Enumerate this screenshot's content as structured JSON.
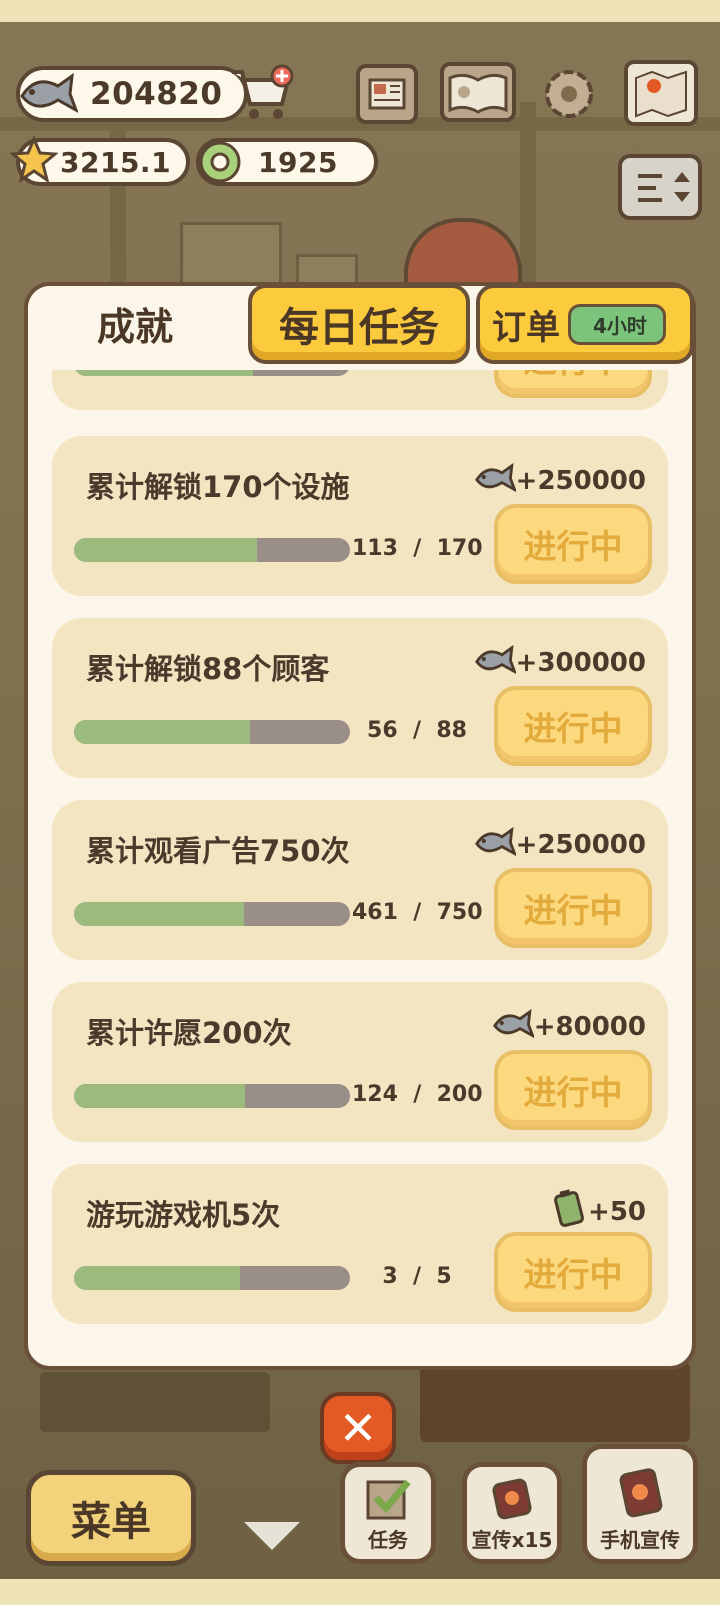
{
  "currencies": {
    "fish": "204820",
    "star": "3215.1",
    "coin": "1925"
  },
  "tabs": {
    "achievements": "成就",
    "daily": "每日任务",
    "orders": "订单",
    "orders_timer": "4小时"
  },
  "achievements": [
    {
      "title": "累计解锁170个设施",
      "reward_icon": "fish-icon",
      "reward": "+250000",
      "current": "113",
      "total": "170",
      "progress": 0.6647,
      "button": "进行中"
    },
    {
      "title": "累计解锁88个顾客",
      "reward_icon": "fish-icon",
      "reward": "+300000",
      "current": "56",
      "total": "88",
      "progress": 0.6364,
      "button": "进行中"
    },
    {
      "title": "累计观看广告750次",
      "reward_icon": "fish-icon",
      "reward": "+250000",
      "current": "461",
      "total": "750",
      "progress": 0.6147,
      "button": "进行中"
    },
    {
      "title": "累计许愿200次",
      "reward_icon": "fish-icon",
      "reward": "+80000",
      "current": "124",
      "total": "200",
      "progress": 0.62,
      "button": "进行中"
    },
    {
      "title": "游玩游戏机5次",
      "reward_icon": "battery-icon",
      "reward": "+50",
      "current": "3",
      "total": "5",
      "progress": 0.6,
      "button": "进行中"
    }
  ],
  "bottom": {
    "menu": "菜单",
    "tasks": "任务",
    "promote": "宣传x15",
    "phone_promote": "手机宣传"
  },
  "colors": {
    "accent_yellow": "#fcca3d",
    "progress_green": "#9dbb7f",
    "close_orange": "#e45a25"
  }
}
